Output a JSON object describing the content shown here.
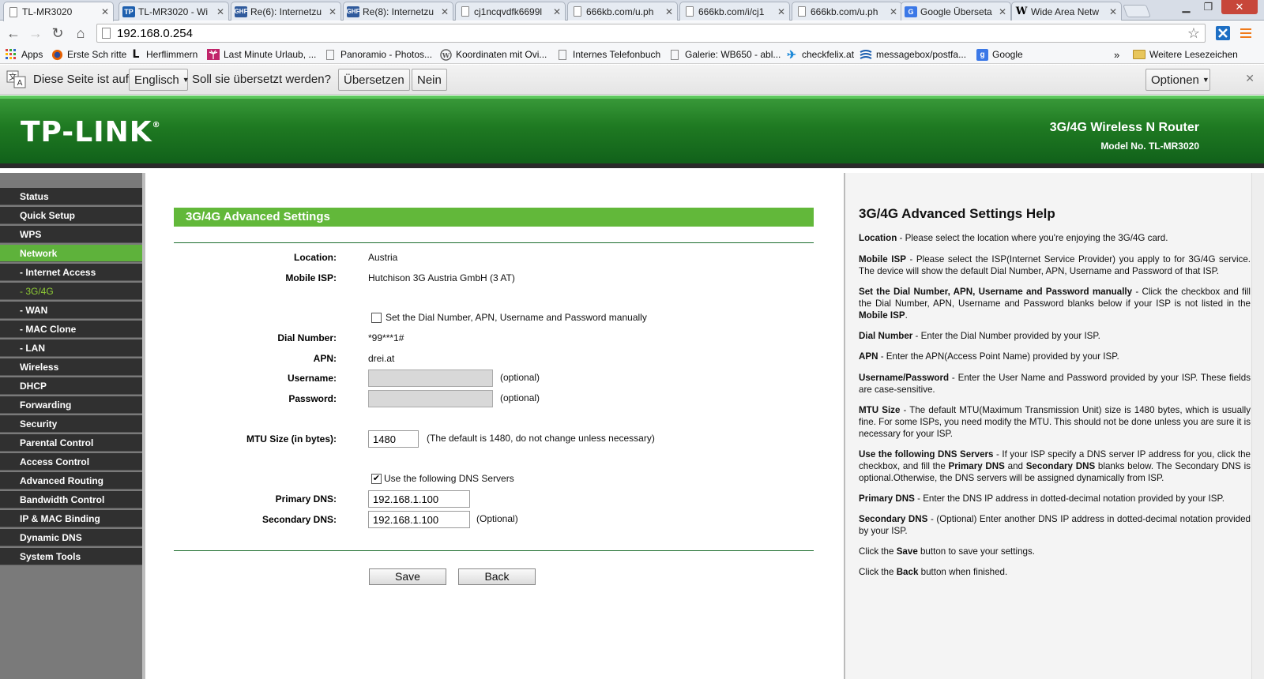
{
  "browser": {
    "tabs": [
      {
        "title": "TL-MR3020",
        "icon": "page-icon",
        "active": true
      },
      {
        "title": "TL-MR3020 - Wi",
        "icon": "tp-icon"
      },
      {
        "title": "Re(6): Internetzu",
        "icon": "ghf-icon"
      },
      {
        "title": "Re(8): Internetzu",
        "icon": "ghf-icon"
      },
      {
        "title": "cj1ncqvdfk6699l",
        "icon": "page-icon"
      },
      {
        "title": "666kb.com/u.ph",
        "icon": "page-icon"
      },
      {
        "title": "666kb.com/i/cj1",
        "icon": "page-icon"
      },
      {
        "title": "666kb.com/u.ph",
        "icon": "page-icon"
      },
      {
        "title": "Google Überseta",
        "icon": "google-translate-icon"
      },
      {
        "title": "Wide Area Netw",
        "icon": "wikipedia-icon"
      }
    ],
    "url": "192.168.0.254",
    "bookmarks": [
      {
        "label": "Apps",
        "icon": "apps-icon"
      },
      {
        "label": "Erste Sch ritte",
        "icon": "firefox-icon"
      },
      {
        "label": "Herflimmern",
        "icon": "l-icon"
      },
      {
        "label": "Last Minute Urlaub, ...",
        "icon": "palm-icon"
      },
      {
        "label": "Panoramio - Photos...",
        "icon": "page-icon"
      },
      {
        "label": "Koordinaten mit Ovi...",
        "icon": "wordpress-icon"
      },
      {
        "label": "Internes Telefonbuch",
        "icon": "page-icon"
      },
      {
        "label": "Galerie: WB650 - abl...",
        "icon": "page-icon"
      },
      {
        "label": "checkfelix.at",
        "icon": "plane-icon"
      },
      {
        "label": "messagebox/postfa...",
        "icon": "messagebox-icon"
      },
      {
        "label": "Google",
        "icon": "google-icon"
      }
    ],
    "more_bookmarks_chevron": "»",
    "other_bookmarks": "Weitere Lesezeichen",
    "translate_bar": {
      "text_prefix": "Diese Seite ist auf",
      "language": "Englisch",
      "question": "Soll sie übersetzt werden?",
      "translate_button": "Übersetzen",
      "no_button": "Nein",
      "options_button": "Optionen"
    }
  },
  "router": {
    "logo": "TP-LINK",
    "product": "3G/4G Wireless N Router",
    "model": "Model No. TL-MR3020",
    "menu": [
      {
        "label": "Status"
      },
      {
        "label": "Quick Setup"
      },
      {
        "label": "WPS"
      },
      {
        "label": "Network",
        "active": true
      },
      {
        "label": "- Internet Access",
        "sub": true
      },
      {
        "label": "- 3G/4G",
        "sub": true,
        "current": true
      },
      {
        "label": "- WAN",
        "sub": true
      },
      {
        "label": "- MAC Clone",
        "sub": true
      },
      {
        "label": "- LAN",
        "sub": true
      },
      {
        "label": "Wireless"
      },
      {
        "label": "DHCP"
      },
      {
        "label": "Forwarding"
      },
      {
        "label": "Security"
      },
      {
        "label": "Parental Control"
      },
      {
        "label": "Access Control"
      },
      {
        "label": "Advanced Routing"
      },
      {
        "label": "Bandwidth Control"
      },
      {
        "label": "IP & MAC Binding"
      },
      {
        "label": "Dynamic DNS"
      },
      {
        "label": "System Tools"
      }
    ],
    "form": {
      "title": "3G/4G Advanced Settings",
      "location_label": "Location:",
      "location_value": "Austria",
      "isp_label": "Mobile ISP:",
      "isp_value": "Hutchison 3G Austria GmbH (3 AT)",
      "manual_checkbox_label": "Set the Dial Number, APN, Username and Password manually",
      "manual_checked": false,
      "dial_label": "Dial Number:",
      "dial_value": "*99***1#",
      "apn_label": "APN:",
      "apn_value": "drei.at",
      "username_label": "Username:",
      "username_value": "",
      "username_hint": "(optional)",
      "password_label": "Password:",
      "password_value": "",
      "password_hint": "(optional)",
      "mtu_label": "MTU Size (in bytes):",
      "mtu_value": "1480",
      "mtu_hint": "(The default is 1480, do not change unless necessary)",
      "dns_checkbox_label": "Use the following DNS Servers",
      "dns_checked": true,
      "primary_dns_label": "Primary DNS:",
      "primary_dns_value": "192.168.1.100",
      "secondary_dns_label": "Secondary DNS:",
      "secondary_dns_value": "192.168.1.100",
      "secondary_dns_hint": "(Optional)",
      "save_button": "Save",
      "back_button": "Back"
    },
    "help": {
      "title": "3G/4G Advanced Settings Help",
      "location_term": "Location",
      "location_text": " - Please select the location where you're enjoying the 3G/4G card.",
      "isp_term": "Mobile ISP",
      "isp_text": " - Please select the ISP(Internet Service Provider) you apply to for 3G/4G service. The device will show the default Dial Number, APN, Username and Password of that ISP.",
      "manual_term": "Set the Dial Number, APN, Username and Password manually",
      "manual_text": " - Click the checkbox and fill the Dial Number, APN, Username and Password blanks below if your ISP is not listed in the ",
      "manual_term2": "Mobile ISP",
      "manual_text2": ".",
      "dial_term": "Dial Number",
      "dial_text": " - Enter the Dial Number provided by your ISP.",
      "apn_term": "APN",
      "apn_text": " - Enter the APN(Access Point Name) provided by your ISP.",
      "userpass_term": "Username/Password",
      "userpass_text": " - Enter the User Name and Password provided by your ISP. These fields are case-sensitive.",
      "mtu_term": "MTU Size",
      "mtu_text": " - The default MTU(Maximum Transmission Unit) size is 1480 bytes, which is usually fine. For some ISPs, you need modify the MTU. This should not be done unless you are sure it is necessary for your ISP.",
      "dns_term": "Use the following DNS Servers",
      "dns_text": " - If your ISP specify a DNS server IP address for you, click the checkbox, and fill the ",
      "dns_term2": "Primary DNS",
      "dns_text2": " and ",
      "dns_term3": "Secondary DNS",
      "dns_text3": " blanks below. The Secondary DNS is optional.Otherwise, the DNS servers will be assigned dynamically from ISP.",
      "pdns_term": "Primary DNS",
      "pdns_text": " - Enter the DNS IP address in dotted-decimal notation provided by your ISP.",
      "sdns_term": "Secondary DNS",
      "sdns_text": " - (Optional) Enter another DNS IP address in dotted-decimal notation provided by your ISP.",
      "save_pre": "Click the ",
      "save_term": "Save",
      "save_post": " button to save your settings.",
      "back_pre": "Click the ",
      "back_term": "Back",
      "back_post": " button when finished."
    }
  }
}
